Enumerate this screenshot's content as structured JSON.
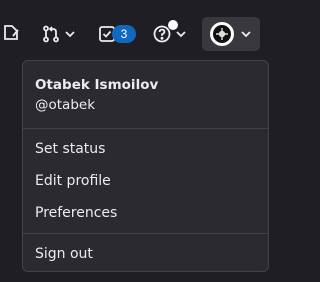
{
  "topbar": {
    "new_issue_icon": "edit-icon",
    "merge_requests_icon": "merge-request-icon",
    "todos_icon": "todo-checkbox-icon",
    "todos_count": "3",
    "help_icon": "question-circle-icon",
    "chevron_icon": "chevron-down-icon"
  },
  "user_menu": {
    "name": "Otabek Ismoilov",
    "handle": "@otabek",
    "items": [
      {
        "label": "Set status"
      },
      {
        "label": "Edit profile"
      },
      {
        "label": "Preferences"
      }
    ],
    "sign_out": "Sign out"
  },
  "colors": {
    "background": "#1f1e24",
    "dropdown_bg": "#2b2a30",
    "badge": "#1068bf",
    "text": "#ececef"
  }
}
